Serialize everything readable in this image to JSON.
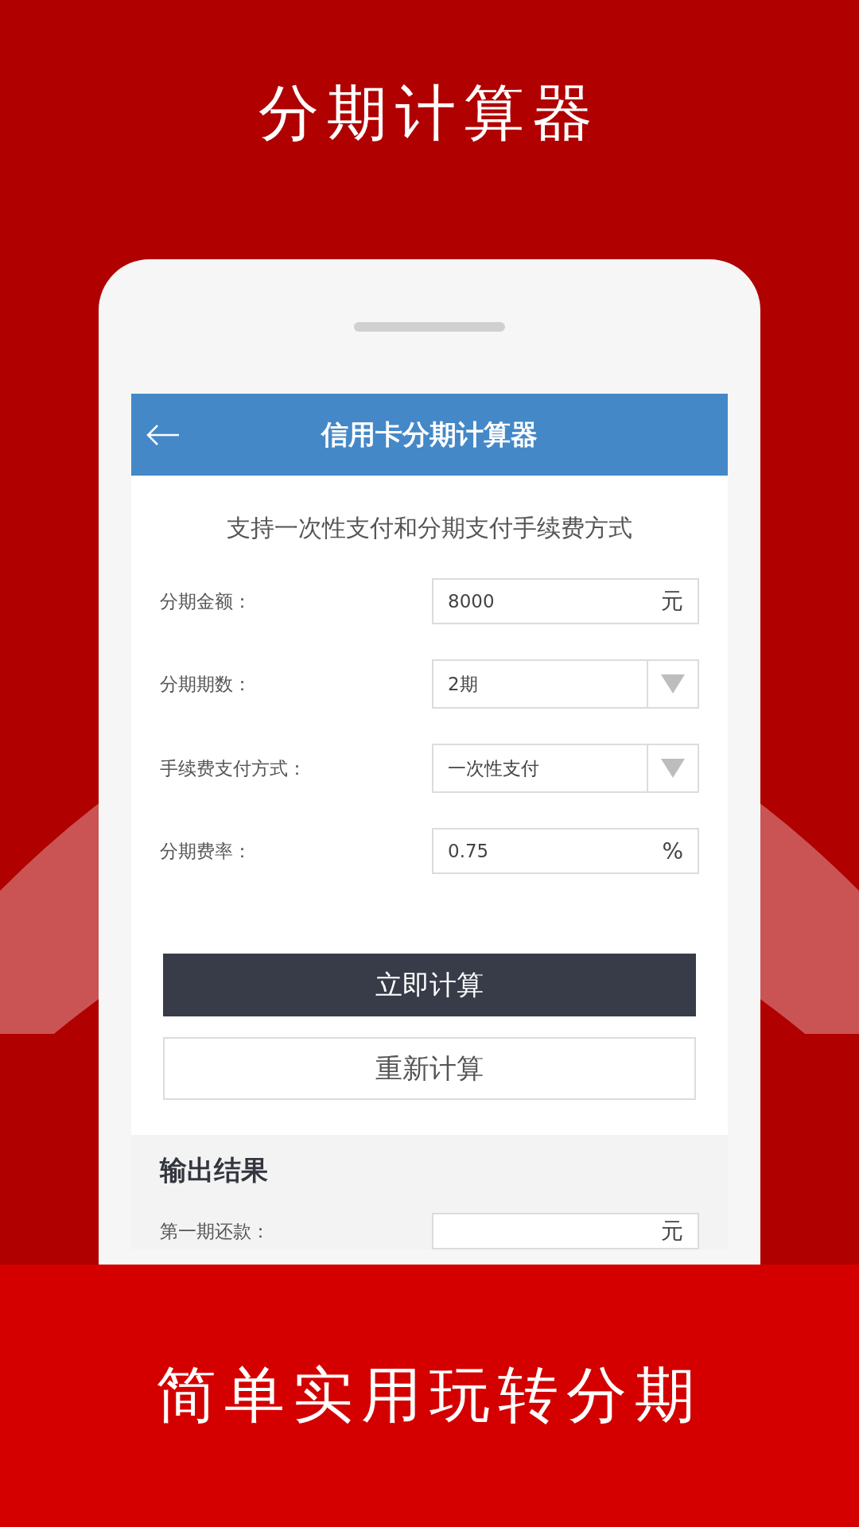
{
  "headline": "分期计算器",
  "app_bar": {
    "title": "信用卡分期计算器"
  },
  "subtitle": "支持一次性支付和分期支付手续费方式",
  "fields": [
    {
      "kind": "input",
      "label": "分期金额：",
      "value": "8000",
      "unit": "元"
    },
    {
      "kind": "select",
      "label": "分期期数：",
      "value": "2期"
    },
    {
      "kind": "select",
      "label": "手续费支付方式：",
      "value": "一次性支付"
    },
    {
      "kind": "input",
      "label": "分期费率：",
      "value": "0.75",
      "unit": "%"
    }
  ],
  "buttons": [
    {
      "kind": "primary",
      "label": "立即计算"
    },
    {
      "kind": "secondary",
      "label": "重新计算"
    }
  ],
  "output": {
    "title": "输出结果",
    "rows": [
      {
        "label": "第一期还款：",
        "unit": "元"
      }
    ]
  },
  "tagline": "简单实用玩转分期"
}
